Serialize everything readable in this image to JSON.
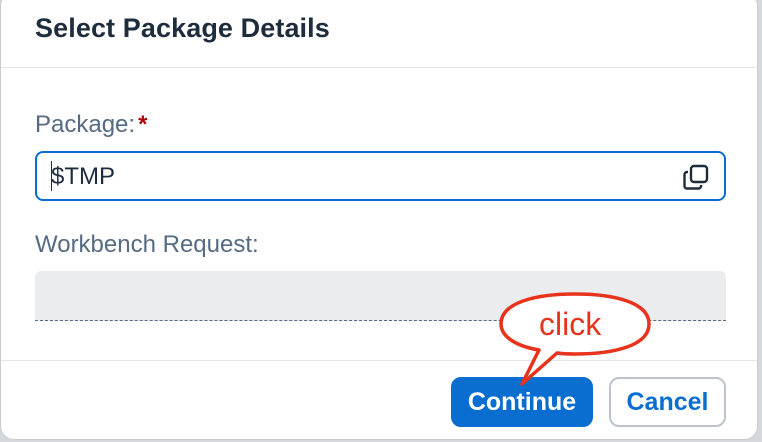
{
  "dialog": {
    "title": "Select Package Details"
  },
  "form": {
    "package_label": "Package:",
    "package_required_marker": "*",
    "package_value": "$TMP",
    "request_label": "Workbench Request:",
    "request_value": ""
  },
  "footer": {
    "continue_label": "Continue",
    "cancel_label": "Cancel"
  },
  "annotation": {
    "callout_text": "click",
    "callout_color": "#e8331c"
  },
  "colors": {
    "accent": "#0a6ed1",
    "title": "#1d2d3e",
    "label": "#556b82",
    "required": "#aa0808"
  },
  "icons": {
    "package_value_help": "copy-icon"
  }
}
